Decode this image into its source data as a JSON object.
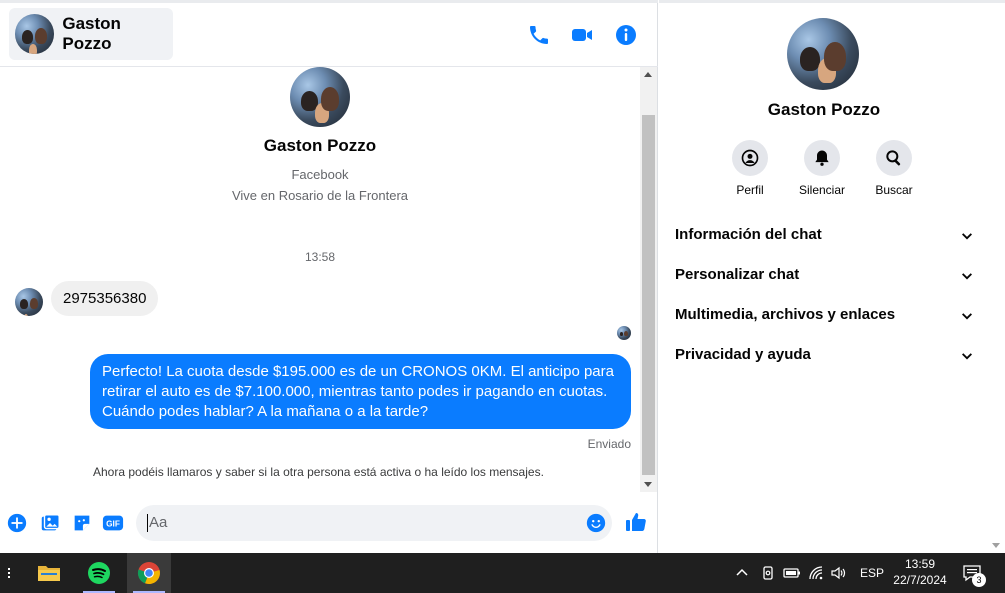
{
  "header": {
    "contact_name": "Gaston Pozzo",
    "icons": [
      "phone-icon",
      "video-icon",
      "info-icon"
    ]
  },
  "thread": {
    "profile_name": "Gaston Pozzo",
    "profile_source": "Facebook",
    "profile_location": "Vive en Rosario de la Frontera",
    "timestamp": "13:58",
    "messages": [
      {
        "direction": "incoming",
        "text": "2975356380"
      },
      {
        "direction": "outgoing",
        "text": "Perfecto! La cuota desde $195.000 es de un CRONOS 0KM. El anticipo para retirar el auto es de $7.100.000, mientras tanto podes ir pagando en cuotas. Cuándo podes hablar? A la mañana o a la tarde?"
      }
    ],
    "sent_status": "Enviado",
    "info_note": "Ahora podéis llamaros y saber si la otra persona está activa o ha leído los mensajes."
  },
  "composer": {
    "placeholder": "Aa",
    "icons": [
      "add-icon",
      "photo-icon",
      "sticker-icon",
      "gif-icon",
      "emoji-icon",
      "like-icon"
    ],
    "gif_label": "GIF"
  },
  "details": {
    "name": "Gaston Pozzo",
    "actions": [
      {
        "label": "Perfil",
        "icon": "profile-icon"
      },
      {
        "label": "Silenciar",
        "icon": "bell-icon"
      },
      {
        "label": "Buscar",
        "icon": "search-icon"
      }
    ],
    "sections": [
      {
        "label": "Información del chat"
      },
      {
        "label": "Personalizar chat"
      },
      {
        "label": "Multimedia, archivos y enlaces"
      },
      {
        "label": "Privacidad y ayuda"
      }
    ]
  },
  "taskbar": {
    "apps": [
      "file-explorer-icon",
      "spotify-icon",
      "chrome-icon"
    ],
    "language": "ESP",
    "time": "13:59",
    "date": "22/7/2024",
    "notification_count": "3"
  },
  "colors": {
    "accent": "#0a7cff",
    "bubble_in": "#f0f0f0",
    "taskbar": "#1f1f1f"
  }
}
